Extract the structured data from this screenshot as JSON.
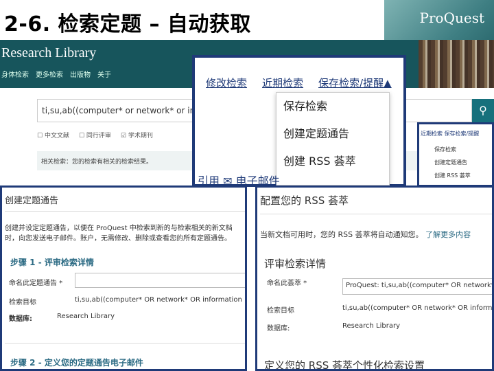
{
  "slide": {
    "title": "2-6. 检索定题 – 自动获取"
  },
  "brand": {
    "logo": "ProQuest",
    "library": "Research Library"
  },
  "nav": [
    "身体检索",
    "更多检索",
    "出版物",
    "关于"
  ],
  "search": {
    "query": "ti,su,ab((computer* or network* or information",
    "button_icon": "search-icon"
  },
  "filters": [
    "中文文献",
    "同行评审",
    "学术期刊"
  ],
  "related": "相关检索：您的检索有相关的检索结果。",
  "popup_menu": {
    "tabs": [
      "修改检索",
      "近期检索",
      "保存检索/提醒▲"
    ],
    "items": [
      "保存检索",
      "创建定题通告",
      "创建 RSS 荟萃"
    ],
    "actions": "引用  ✉ 电子邮件"
  },
  "small_menu": {
    "tabs": "近期检索  保存检索/提醒",
    "items": [
      "保存检索",
      "创建定题通告",
      "创建 RSS 荟萃"
    ]
  },
  "alert_panel": {
    "title": "创建定题通告",
    "description": "创建并设定定题通告，以便在 ProQuest 中检索到新的与检索相关的新文档时，向您发送电子邮件。账户，无需修改、删除或查看您的所有定题通告。",
    "step1": "步骤 1 - 评审检索详情",
    "name_label": "命名此定题通告 *",
    "name_value": "",
    "target_label": "检索目标",
    "target_value": "ti,su,ab((computer* OR network* OR information",
    "db_label": "数据库:",
    "db_value": "Research Library",
    "step2": "步骤 2 - 定义您的定题通告电子邮件"
  },
  "rss_panel": {
    "title": "配置您的 RSS 荟萃",
    "description": "当新文档可用时，您的 RSS 荟萃将自动通知您。",
    "learn_more": "了解更多内容",
    "review_heading": "评审检索详情",
    "name_label": "命名此荟萃 *",
    "name_value": "ProQuest: ti,su,ab((computer* OR network* O",
    "target_label": "检索目标",
    "target_value": "ti,su,ab((computer* OR network* OR informat",
    "db_label": "数据库:",
    "db_value": "Research Library",
    "footer": "定义您的 RSS 荟萃个性化检索设置"
  }
}
